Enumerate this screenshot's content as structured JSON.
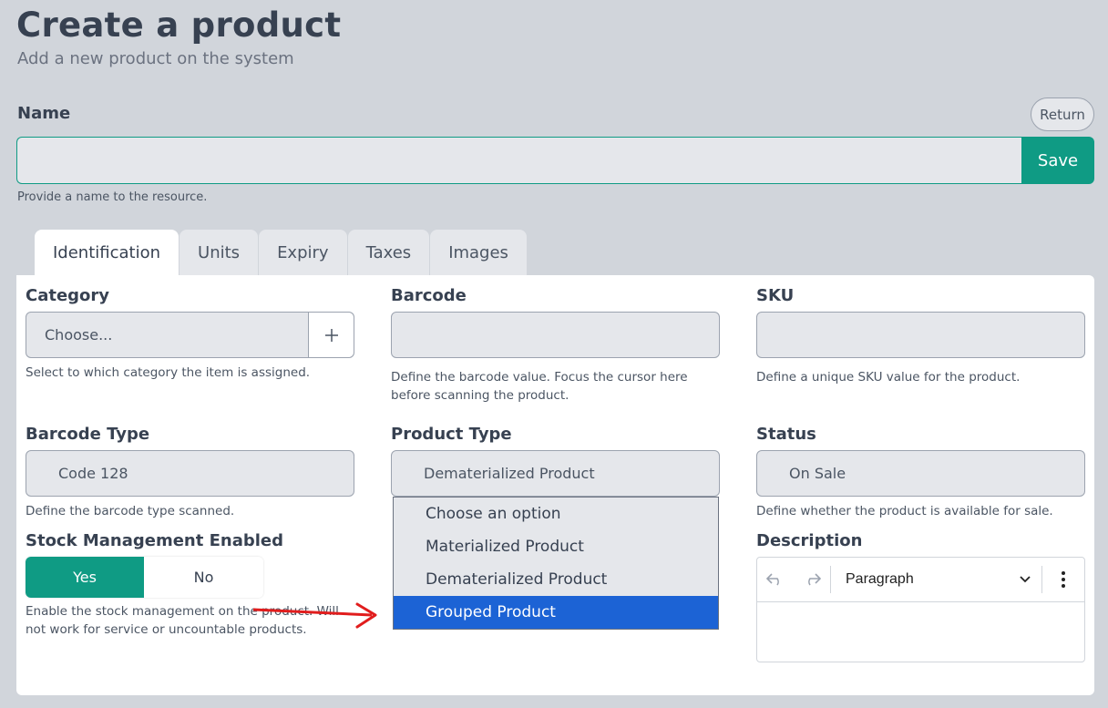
{
  "header": {
    "title": "Create a product",
    "subtitle": "Add a new product on the system"
  },
  "name_field": {
    "label": "Name",
    "value": "",
    "help": "Provide a name to the resource.",
    "return_label": "Return",
    "save_label": "Save"
  },
  "tabs": [
    {
      "label": "Identification",
      "active": true
    },
    {
      "label": "Units",
      "active": false
    },
    {
      "label": "Expiry",
      "active": false
    },
    {
      "label": "Taxes",
      "active": false
    },
    {
      "label": "Images",
      "active": false
    }
  ],
  "fields": {
    "category": {
      "label": "Category",
      "value": "Choose...",
      "help": "Select to which category the item is assigned.",
      "add_icon": "plus-icon"
    },
    "barcode": {
      "label": "Barcode",
      "value": "",
      "help": "Define the barcode value. Focus the cursor here before scanning the product."
    },
    "sku": {
      "label": "SKU",
      "value": "",
      "help": "Define a unique SKU value for the product."
    },
    "barcode_type": {
      "label": "Barcode Type",
      "value": "Code 128",
      "help": "Define the barcode type scanned."
    },
    "product_type": {
      "label": "Product Type",
      "value": "Dematerialized Product",
      "options": [
        "Choose an option",
        "Materialized Product",
        "Dematerialized Product",
        "Grouped Product"
      ],
      "highlighted_option": "Grouped Product"
    },
    "status": {
      "label": "Status",
      "value": "On Sale",
      "help": "Define whether the product is available for sale."
    },
    "stock_management": {
      "label": "Stock Management Enabled",
      "yes_label": "Yes",
      "no_label": "No",
      "selected": "Yes",
      "help": "Enable the stock management on the product. Will not work for service or uncountable products."
    },
    "description": {
      "label": "Description",
      "toolbar": {
        "undo_icon": "undo-icon",
        "redo_icon": "redo-icon",
        "block_format": "Paragraph",
        "more_icon": "more-vertical-icon"
      },
      "content": ""
    }
  },
  "colors": {
    "accent": "#0f9b84",
    "highlight": "#1c63d5",
    "annotation_arrow": "#e11d1d"
  }
}
